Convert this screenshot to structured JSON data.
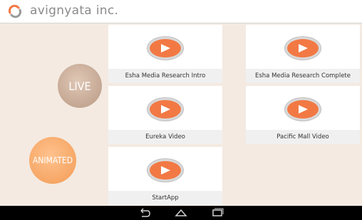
{
  "app": {
    "title": "avignyata inc."
  },
  "categories": {
    "live": "LIVE",
    "animated": "ANIMATED"
  },
  "videos": [
    {
      "title": "Esha Media Research Intro"
    },
    {
      "title": "Esha Media Research Complete"
    },
    {
      "title": "Eureka Video"
    },
    {
      "title": "Pacific Mall Video"
    },
    {
      "title": "StartApp"
    }
  ],
  "colors": {
    "accent": "#f27944",
    "live_circle": "#c7a894",
    "animated_circle": "#f7a665"
  },
  "nav": {
    "icons": [
      "back-icon",
      "home-icon",
      "recents-icon"
    ]
  }
}
